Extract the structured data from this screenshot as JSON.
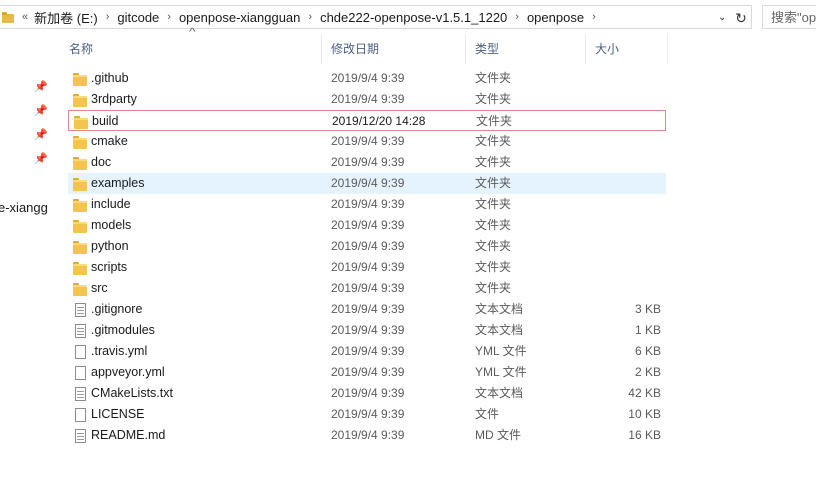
{
  "address": {
    "overflow": "«",
    "crumbs": [
      "新加卷 (E:)",
      "gitcode",
      "openpose-xiangguan",
      "chde222-openpose-v1.5.1_1220",
      "openpose"
    ],
    "separator": "›",
    "dropdown": "⌄",
    "refresh": "↻"
  },
  "search": {
    "placeholder": "搜索\"op"
  },
  "nav": {
    "label": "e-xiangg",
    "pin_glyph": "📌"
  },
  "columns": {
    "name": "名称",
    "date": "修改日期",
    "type": "类型",
    "size": "大小",
    "sort_indicator": "^"
  },
  "colors": {
    "header_text": "#4d6082",
    "hover_bg": "#e5f3ff",
    "highlight_border": "#e58585",
    "folder": "#f5c44e"
  },
  "files": [
    {
      "name": ".github",
      "date": "2019/9/4 9:39",
      "type": "文件夹",
      "size": "",
      "icon": "folder-icon"
    },
    {
      "name": "3rdparty",
      "date": "2019/9/4 9:39",
      "type": "文件夹",
      "size": "",
      "icon": "folder-icon"
    },
    {
      "name": "build",
      "date": "2019/12/20 14:28",
      "type": "文件夹",
      "size": "",
      "icon": "folder-icon"
    },
    {
      "name": "cmake",
      "date": "2019/9/4 9:39",
      "type": "文件夹",
      "size": "",
      "icon": "folder-icon"
    },
    {
      "name": "doc",
      "date": "2019/9/4 9:39",
      "type": "文件夹",
      "size": "",
      "icon": "folder-icon"
    },
    {
      "name": "examples",
      "date": "2019/9/4 9:39",
      "type": "文件夹",
      "size": "",
      "icon": "folder-icon"
    },
    {
      "name": "include",
      "date": "2019/9/4 9:39",
      "type": "文件夹",
      "size": "",
      "icon": "folder-icon"
    },
    {
      "name": "models",
      "date": "2019/9/4 9:39",
      "type": "文件夹",
      "size": "",
      "icon": "folder-icon"
    },
    {
      "name": "python",
      "date": "2019/9/4 9:39",
      "type": "文件夹",
      "size": "",
      "icon": "folder-icon"
    },
    {
      "name": "scripts",
      "date": "2019/9/4 9:39",
      "type": "文件夹",
      "size": "",
      "icon": "folder-icon"
    },
    {
      "name": "src",
      "date": "2019/9/4 9:39",
      "type": "文件夹",
      "size": "",
      "icon": "folder-icon"
    },
    {
      "name": ".gitignore",
      "date": "2019/9/4 9:39",
      "type": "文本文档",
      "size": "3 KB",
      "icon": "text-file-icon"
    },
    {
      "name": ".gitmodules",
      "date": "2019/9/4 9:39",
      "type": "文本文档",
      "size": "1 KB",
      "icon": "text-file-icon"
    },
    {
      "name": ".travis.yml",
      "date": "2019/9/4 9:39",
      "type": "YML 文件",
      "size": "6 KB",
      "icon": "file-icon"
    },
    {
      "name": "appveyor.yml",
      "date": "2019/9/4 9:39",
      "type": "YML 文件",
      "size": "2 KB",
      "icon": "file-icon"
    },
    {
      "name": "CMakeLists.txt",
      "date": "2019/9/4 9:39",
      "type": "文本文档",
      "size": "42 KB",
      "icon": "text-file-icon"
    },
    {
      "name": "LICENSE",
      "date": "2019/9/4 9:39",
      "type": "文件",
      "size": "10 KB",
      "icon": "file-icon"
    },
    {
      "name": "README.md",
      "date": "2019/9/4 9:39",
      "type": "MD 文件",
      "size": "16 KB",
      "icon": "text-file-icon"
    }
  ],
  "highlighted_row": "build",
  "hovered_row": "examples"
}
